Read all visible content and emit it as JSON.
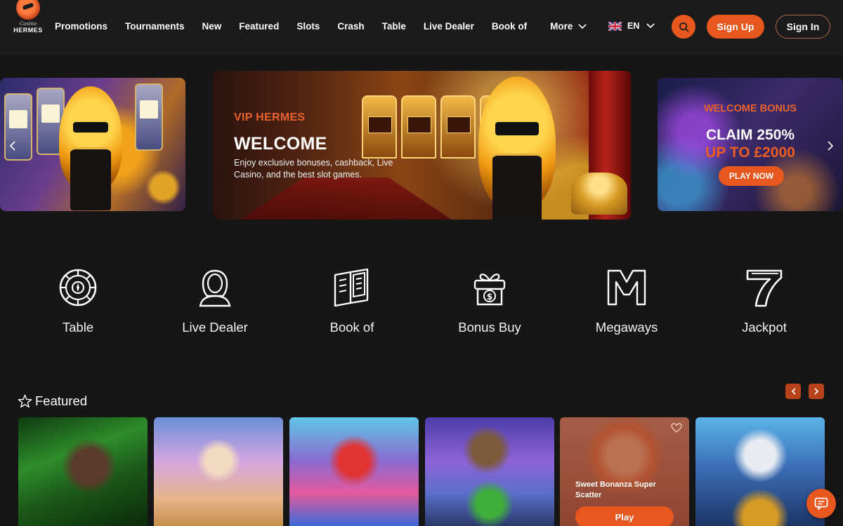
{
  "header": {
    "logo_script": "Casino",
    "logo_name": "HERMES",
    "nav": [
      "Promotions",
      "Tournaments",
      "New",
      "Featured",
      "Slots",
      "Crash",
      "Table",
      "Live Dealer",
      "Book of"
    ],
    "more_label": "More",
    "language": "EN",
    "signup_label": "Sign Up",
    "signin_label": "Sign In"
  },
  "banners": {
    "center": {
      "eyebrow": "VIP HERMES",
      "title": "WELCOME",
      "description": "Enjoy exclusive bonuses, cashback, Live Casino, and the best slot games."
    },
    "right": {
      "eyebrow": "WELCOME BONUS",
      "claim": "CLAIM 250%",
      "amount": "UP TO £2000",
      "cta": "PLAY NOW"
    }
  },
  "categories": [
    {
      "label": "Table",
      "icon": "roulette-icon"
    },
    {
      "label": "Live Dealer",
      "icon": "dealer-icon"
    },
    {
      "label": "Book of",
      "icon": "book-icon"
    },
    {
      "label": "Bonus Buy",
      "icon": "gift-dollar-icon"
    },
    {
      "label": "Megaways",
      "icon": "megaways-m-icon"
    },
    {
      "label": "Jackpot",
      "icon": "seven-icon"
    }
  ],
  "featured": {
    "title": "Featured",
    "hover_card": {
      "name": "Sweet Bonanza Super Scatter",
      "play_label": "Play"
    }
  },
  "colors": {
    "accent": "#e8571e",
    "background": "#161617",
    "header": "#1b1b1c"
  }
}
